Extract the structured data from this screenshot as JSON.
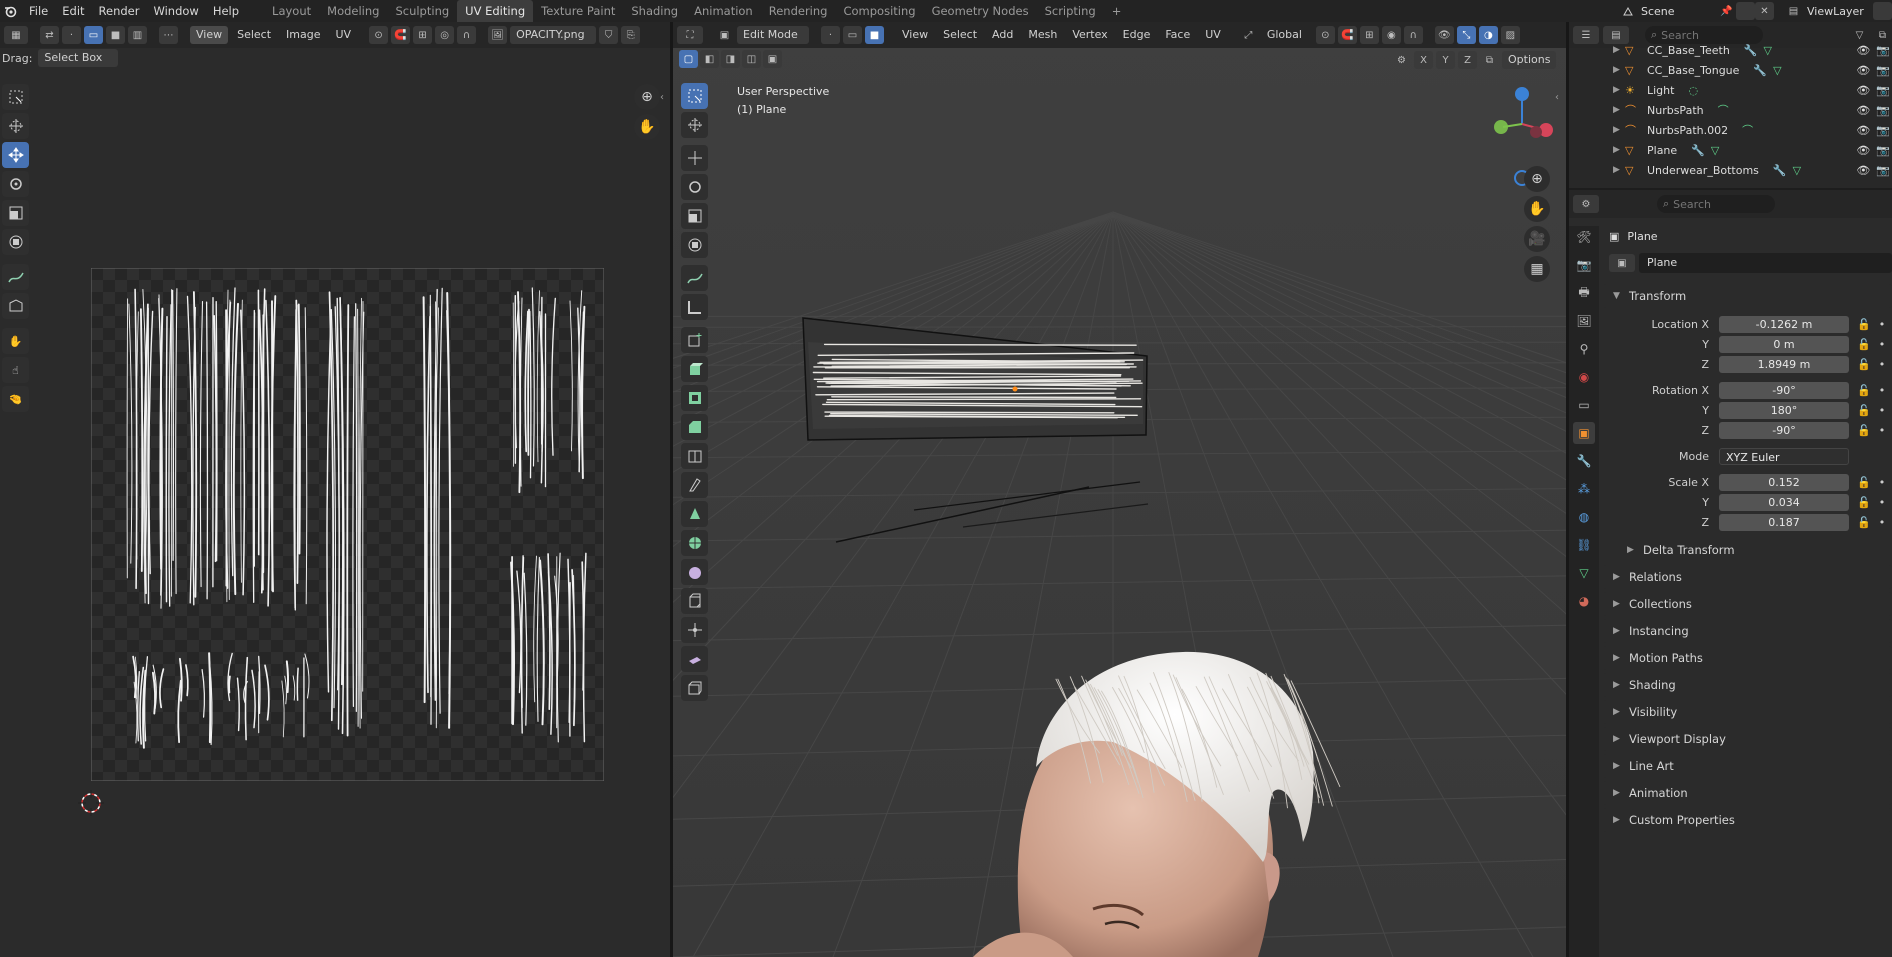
{
  "topbar": {
    "menus": [
      "File",
      "Edit",
      "Render",
      "Window",
      "Help"
    ],
    "workspaces": [
      "Layout",
      "Modeling",
      "Sculpting",
      "UV Editing",
      "Texture Paint",
      "Shading",
      "Animation",
      "Rendering",
      "Compositing",
      "Geometry Nodes",
      "Scripting"
    ],
    "active_workspace": "UV Editing",
    "add_workspace": "+",
    "scene_label": "Scene",
    "viewlayer_label": "ViewLayer"
  },
  "uv_editor": {
    "menus": [
      "View",
      "Select",
      "Image",
      "UV"
    ],
    "image_name": "OPACITY.png",
    "drag_label": "Drag:",
    "drag_value": "Select Box"
  },
  "viewport": {
    "mode": "Edit Mode",
    "menus": [
      "View",
      "Select",
      "Add",
      "Mesh",
      "Vertex",
      "Edge",
      "Face",
      "UV"
    ],
    "orientation": "Global",
    "axis_buttons": [
      "X",
      "Y",
      "Z"
    ],
    "options_label": "Options",
    "overlay_line1": "User Perspective",
    "overlay_line2": "(1) Plane"
  },
  "outliner": {
    "search_placeholder": "Search",
    "items": [
      {
        "name": "CC_Base_Teeth",
        "type": "mesh"
      },
      {
        "name": "CC_Base_Tongue",
        "type": "mesh"
      },
      {
        "name": "Light",
        "type": "light"
      },
      {
        "name": "NurbsPath",
        "type": "curve"
      },
      {
        "name": "NurbsPath.002",
        "type": "curve"
      },
      {
        "name": "Plane",
        "type": "mesh"
      },
      {
        "name": "Underwear_Bottoms",
        "type": "mesh"
      }
    ]
  },
  "properties": {
    "search_placeholder": "Search",
    "object_name": "Plane",
    "datablock_name": "Plane",
    "transform_title": "Transform",
    "location_label": "Location X",
    "location": [
      "-0.1262 m",
      "0 m",
      "1.8949 m"
    ],
    "rotation_label": "Rotation X",
    "rotation": [
      "-90°",
      "180°",
      "-90°"
    ],
    "mode_label": "Mode",
    "mode_value": "XYZ Euler",
    "scale_label": "Scale X",
    "scale": [
      "0.152",
      "0.034",
      "0.187"
    ],
    "axis_y": "Y",
    "axis_z": "Z",
    "delta_transform": "Delta Transform",
    "panels": [
      "Relations",
      "Collections",
      "Instancing",
      "Motion Paths",
      "Shading",
      "Visibility",
      "Viewport Display",
      "Line Art",
      "Animation",
      "Custom Properties"
    ]
  },
  "colors": {
    "accent_blue": "#4772b3",
    "panel_bg": "#303030",
    "viewport_bg": "#3d3d3d",
    "uv_bg": "#2b2b2b"
  }
}
